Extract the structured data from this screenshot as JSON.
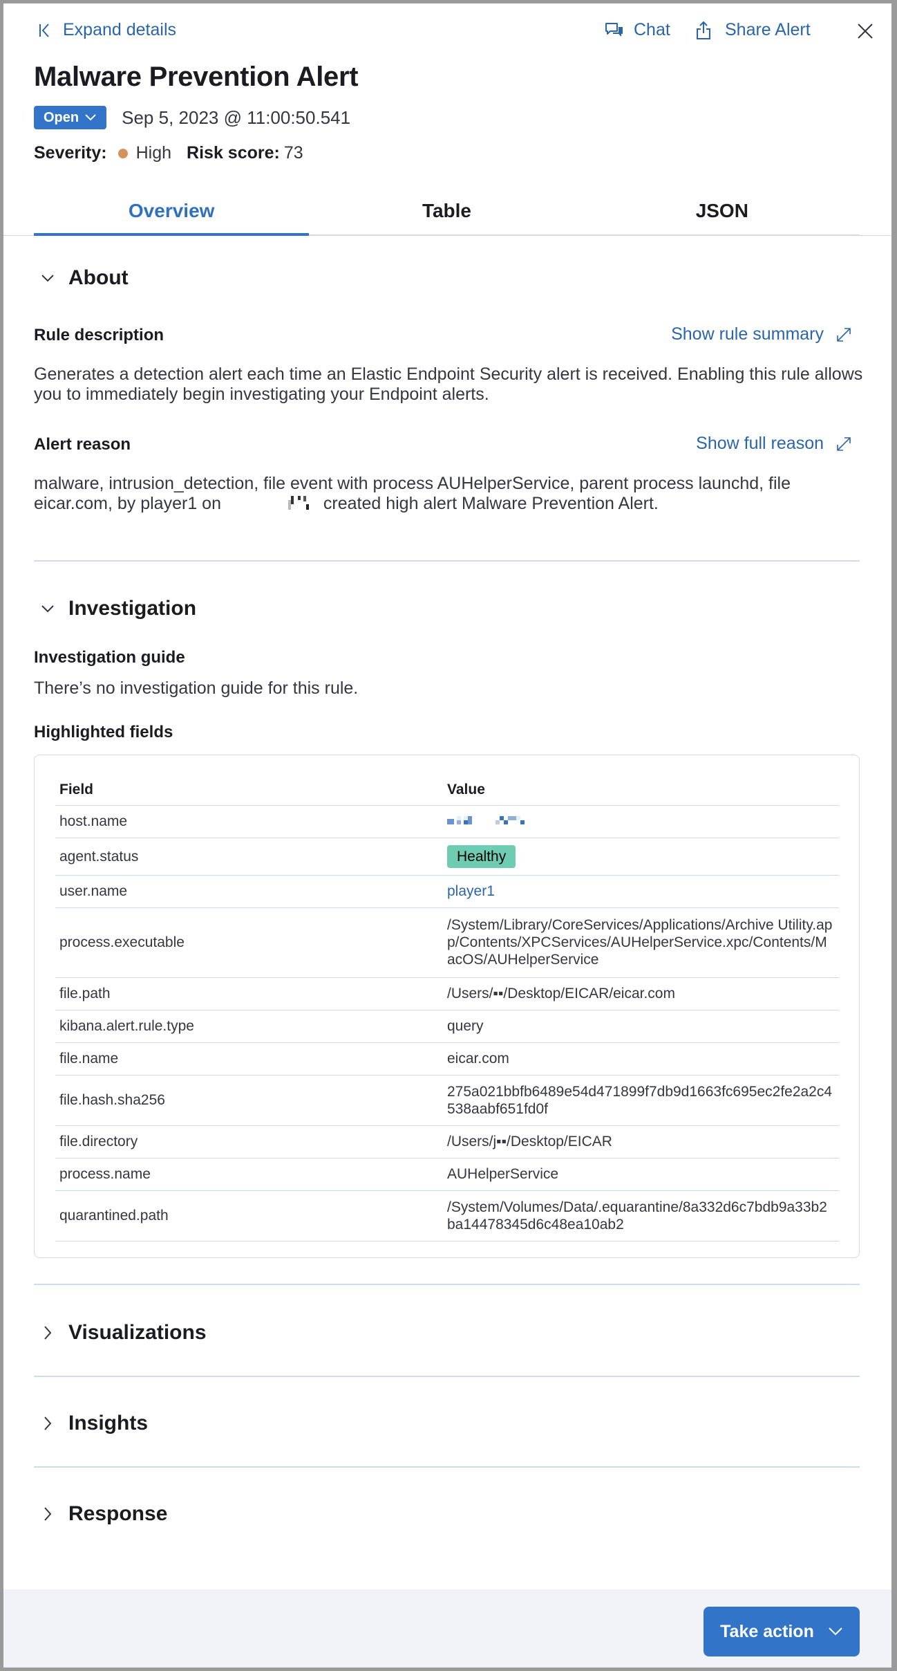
{
  "header": {
    "expand_label": "Expand details",
    "chat_label": "Chat",
    "share_label": "Share Alert",
    "title": "Malware Prevention Alert",
    "status": "Open",
    "timestamp": "Sep 5, 2023 @ 11:00:50.541",
    "severity_label": "Severity:",
    "severity_value": "High",
    "severity_color": "#d6925a",
    "risk_label": "Risk score:",
    "risk_value": "73"
  },
  "tabs": [
    {
      "label": "Overview",
      "active": true
    },
    {
      "label": "Table",
      "active": false
    },
    {
      "label": "JSON",
      "active": false
    }
  ],
  "about": {
    "title": "About",
    "rule_description_label": "Rule description",
    "show_rule_summary": "Show rule summary",
    "rule_description": "Generates a detection alert each time an Elastic Endpoint Security alert is received. Enabling this rule allows you to immediately begin investigating your Endpoint alerts.",
    "alert_reason_label": "Alert reason",
    "show_full_reason": "Show full reason",
    "alert_reason_part1": "malware, intrusion_detection, file event with process AUHelperService, parent process launchd, file eicar.com, by player1 on",
    "alert_reason_part2": "created high alert Malware Prevention Alert."
  },
  "investigation": {
    "title": "Investigation",
    "guide_label": "Investigation guide",
    "guide_text": "There’s no investigation guide for this rule.",
    "highlighted_label": "Highlighted fields",
    "columns": {
      "field": "Field",
      "value": "Value"
    },
    "rows": [
      {
        "field": "host.name",
        "value": "",
        "type": "redacted-link"
      },
      {
        "field": "agent.status",
        "value": "Healthy",
        "type": "badge"
      },
      {
        "field": "user.name",
        "value": "player1",
        "type": "link"
      },
      {
        "field": "process.executable",
        "value": "/System/Library/CoreServices/Applications/Archive Utility.app/Contents/XPCServices/AUHelperService.xpc/Contents/MacOS/AUHelperService",
        "type": "text"
      },
      {
        "field": "file.path",
        "value": "/Users/▪▪/Desktop/EICAR/eicar.com",
        "type": "text"
      },
      {
        "field": "kibana.alert.rule.type",
        "value": "query",
        "type": "text"
      },
      {
        "field": "file.name",
        "value": "eicar.com",
        "type": "text"
      },
      {
        "field": "file.hash.sha256",
        "value": "275a021bbfb6489e54d471899f7db9d1663fc695ec2fe2a2c4538aabf651fd0f",
        "type": "text"
      },
      {
        "field": "file.directory",
        "value": "/Users/j▪▪/Desktop/EICAR",
        "type": "text"
      },
      {
        "field": "process.name",
        "value": "AUHelperService",
        "type": "text"
      },
      {
        "field": "quarantined.path",
        "value": "/System/Volumes/Data/.equarantine/8a332d6c7bdb9a33b2ba14478345d6c48ea10ab2",
        "type": "text"
      }
    ]
  },
  "sections": {
    "visualizations": "Visualizations",
    "insights": "Insights",
    "response": "Response"
  },
  "footer": {
    "take_action": "Take action"
  },
  "colors": {
    "accent": "#3274c7",
    "link": "#2a65ab",
    "healthy_badge": "#6dccb1"
  }
}
